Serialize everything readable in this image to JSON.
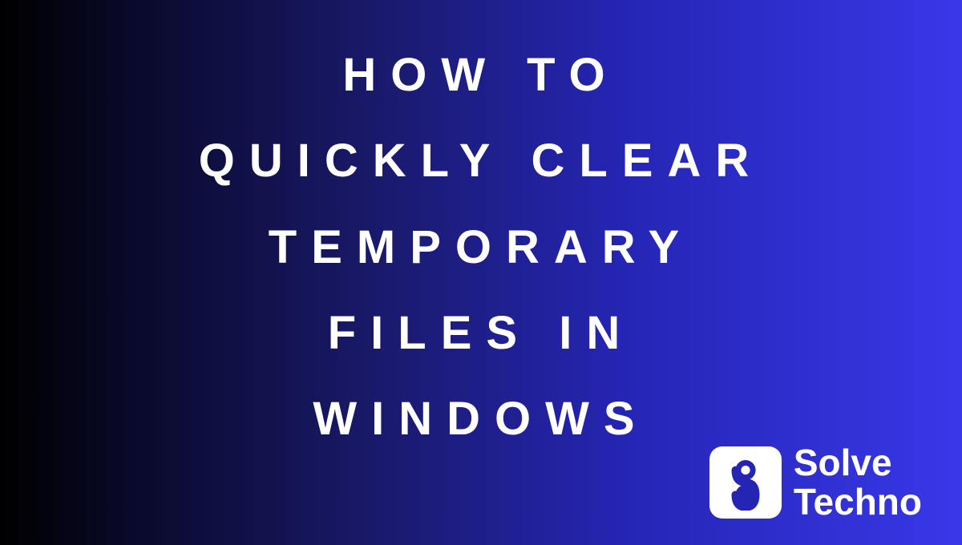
{
  "title": {
    "line1": "HOW TO",
    "line2": "QUICKLY CLEAR",
    "line3": "TEMPORARY",
    "line4": "FILES IN",
    "line5": "WINDOWS"
  },
  "logo": {
    "brand_line1": "Solve",
    "brand_line2": "Techno"
  }
}
